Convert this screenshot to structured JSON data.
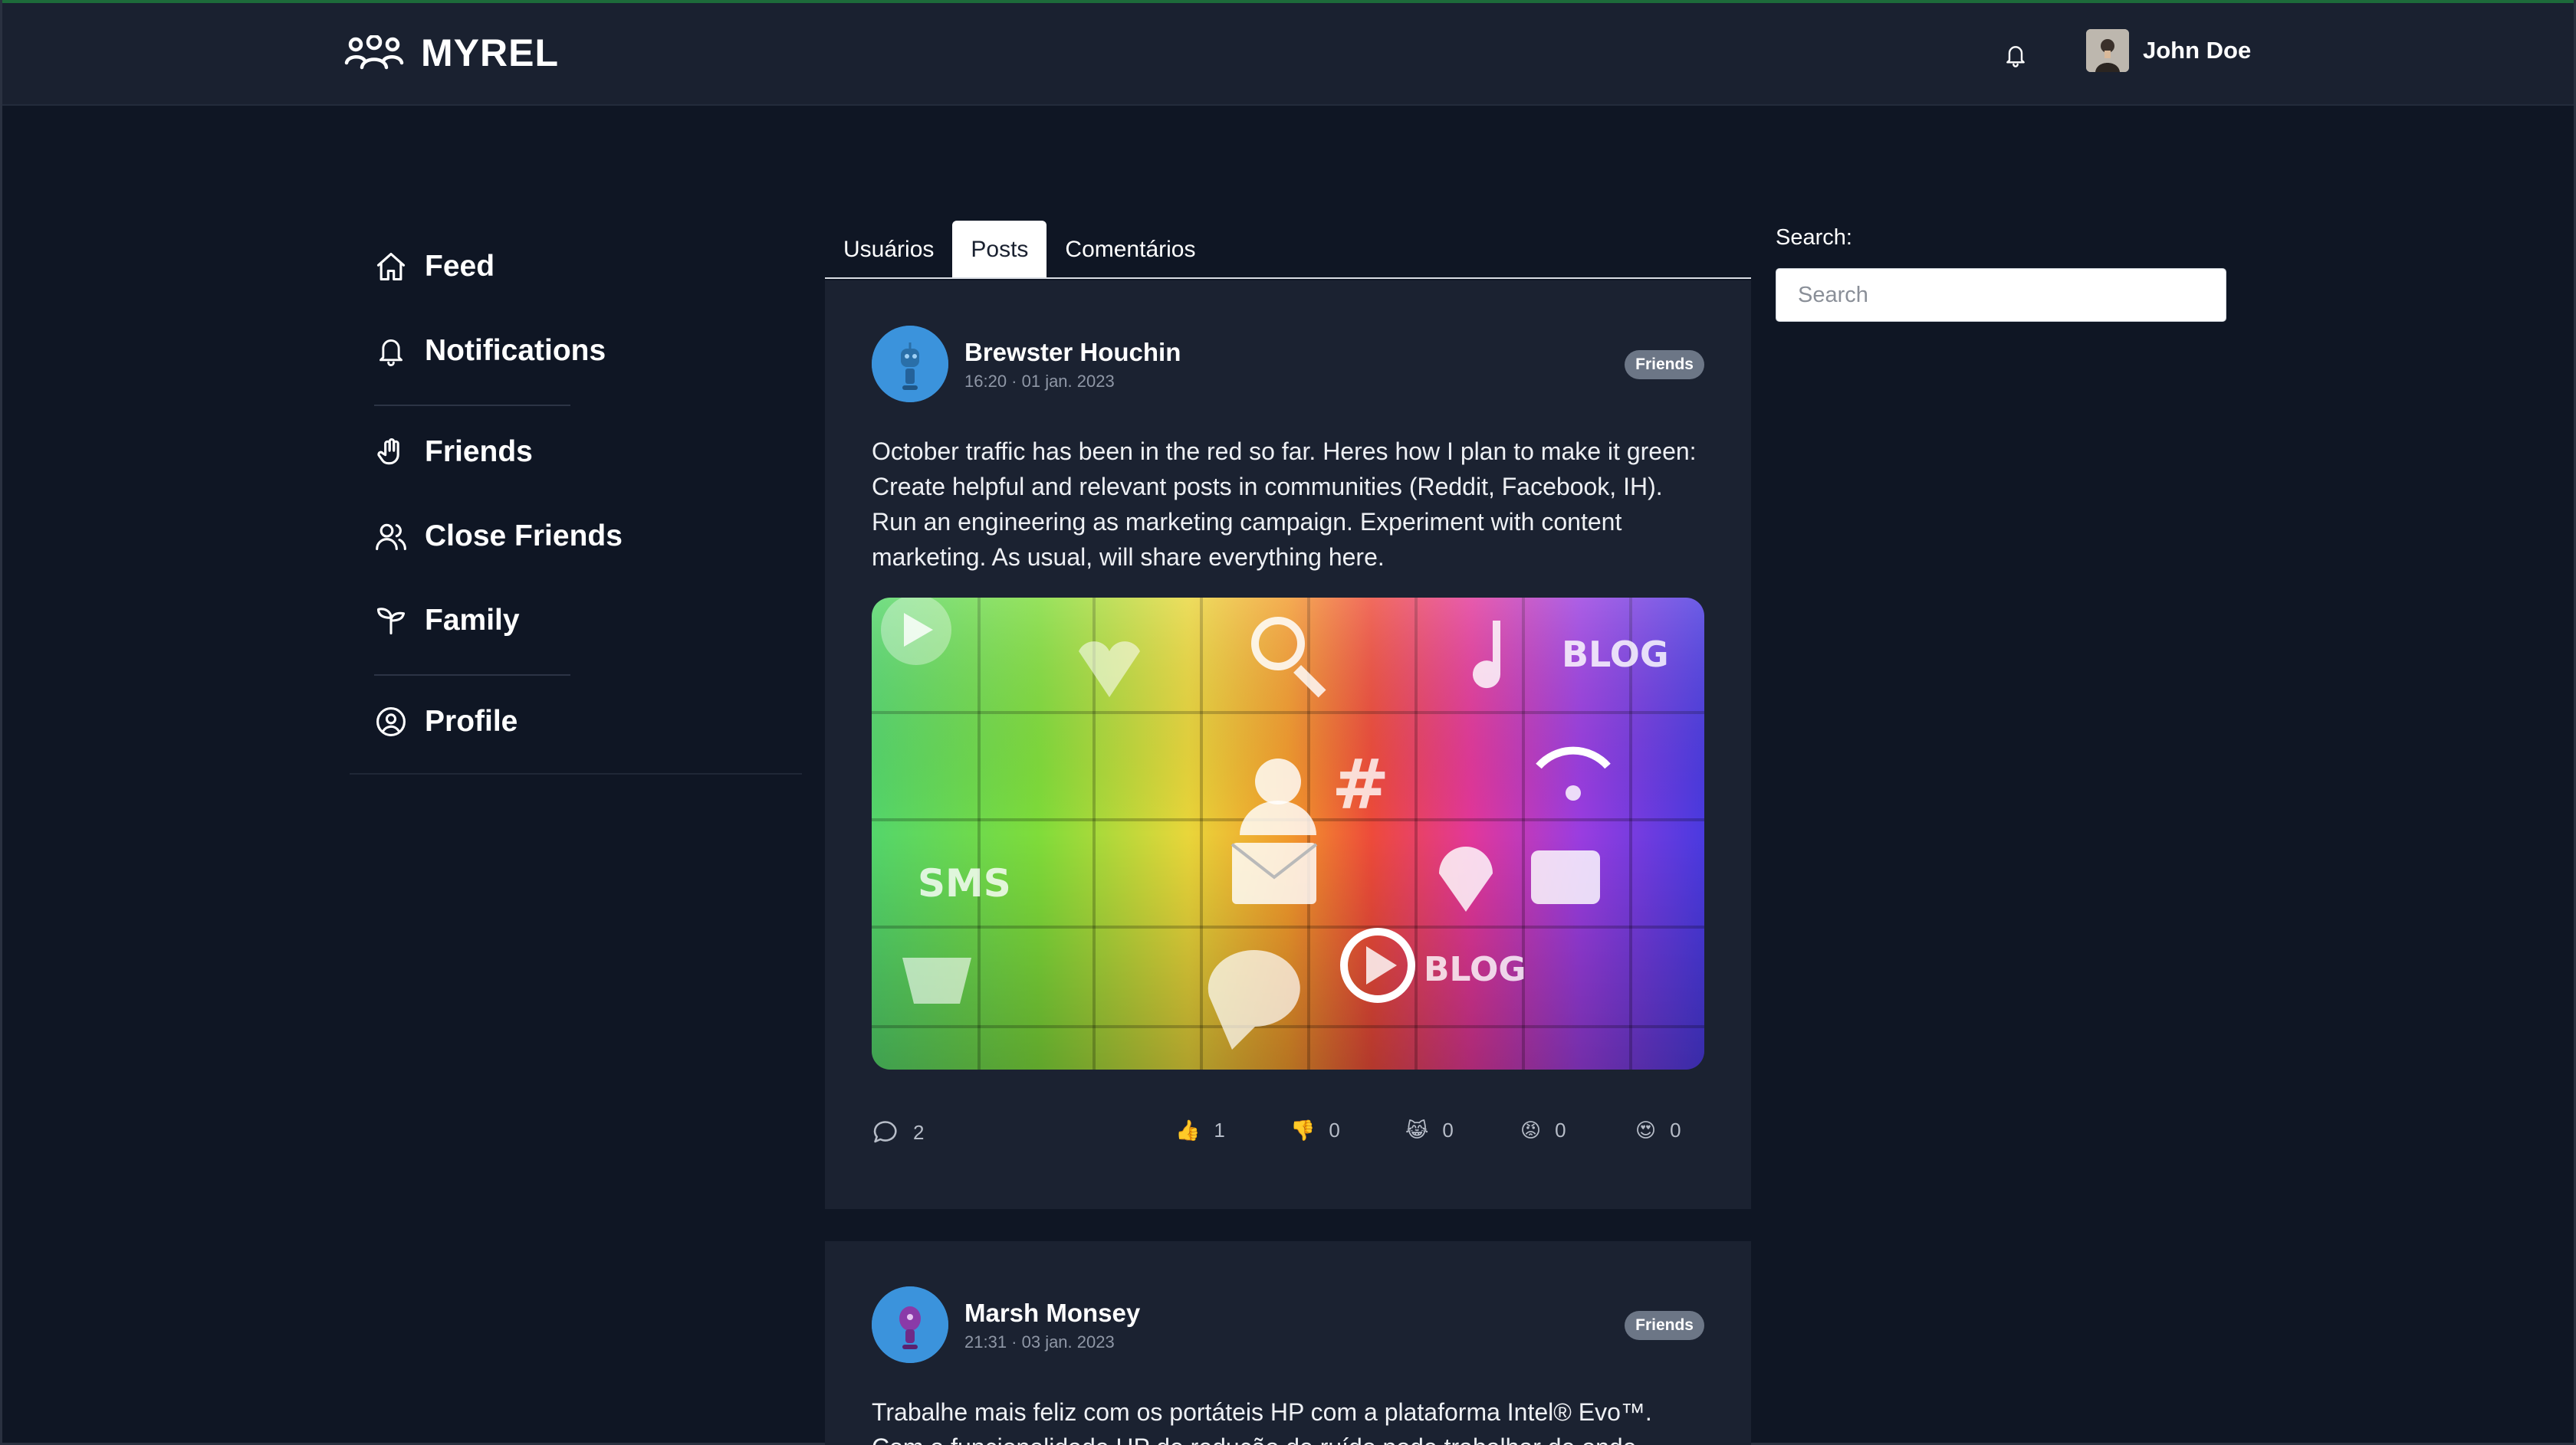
{
  "app": {
    "name": "MYREL",
    "user_name": "John Doe"
  },
  "icons": {
    "logo": "people-group-icon",
    "notifications": "bell-icon",
    "home": "home-icon",
    "friends": "hand-icon",
    "close_friends": "users-icon",
    "family": "sprout-icon",
    "profile": "user-circle-icon",
    "comment": "comment-bubble-icon"
  },
  "sidebar": {
    "items": [
      {
        "label": "Feed"
      },
      {
        "label": "Notifications"
      },
      {
        "label": "Friends"
      },
      {
        "label": "Close Friends"
      },
      {
        "label": "Family"
      },
      {
        "label": "Profile"
      }
    ]
  },
  "tabs": [
    {
      "label": "Usuários",
      "active": false
    },
    {
      "label": "Posts",
      "active": true
    },
    {
      "label": "Comentários",
      "active": false
    }
  ],
  "search": {
    "label": "Search:",
    "placeholder": "Search"
  },
  "posts": [
    {
      "author": "Brewster Houchin",
      "date": "16:20 · 01 jan. 2023",
      "badge": "Friends",
      "text": "October traffic has been in the red so far. Heres how I plan to make it green: Create helpful and relevant posts in communities (Reddit, Facebook, IH). Run an engineering as marketing campaign. Experiment with content marketing. As usual, will share everything here.",
      "comments": "2",
      "reactions": [
        {
          "emoji": "👍",
          "count": "1"
        },
        {
          "emoji": "👎",
          "count": "0"
        },
        {
          "emoji": "😹",
          "count": "0"
        },
        {
          "emoji": "😡",
          "count": "0"
        },
        {
          "emoji": "😍",
          "count": "0"
        }
      ]
    },
    {
      "author": "Marsh Monsey",
      "date": "21:31 · 03 jan. 2023",
      "badge": "Friends",
      "text": "Trabalhe mais feliz com os portáteis HP com a plataforma Intel® Evo™. Com a funcionalidade HP de redução de ruído pode trabalhar de onde"
    }
  ],
  "colors": {
    "background": "#0f1624",
    "header": "#1a2130",
    "card": "#1b2231",
    "badge": "#6c7686",
    "accent_line": "#1d6b3a"
  }
}
